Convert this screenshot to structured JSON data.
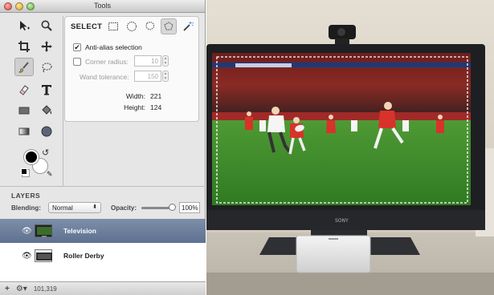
{
  "window": {
    "title": "Tools"
  },
  "tools": [
    {
      "icon": "arrow-move-icon"
    },
    {
      "icon": "magnifier-icon"
    },
    {
      "icon": "crop-icon"
    },
    {
      "icon": "pan-icon"
    },
    {
      "icon": "brush-icon"
    },
    {
      "icon": "lasso-icon"
    },
    {
      "icon": "eraser-icon"
    },
    {
      "icon": "text-icon"
    },
    {
      "icon": "rectangle-icon"
    },
    {
      "icon": "paint-bucket-icon"
    },
    {
      "icon": "gradient-icon"
    },
    {
      "icon": "ellipse-icon"
    }
  ],
  "select_options": {
    "heading": "SELECT",
    "modes": [
      "rect-select-icon",
      "ellipse-select-icon",
      "lasso-select-icon",
      "polygon-select-icon",
      "magic-wand-icon"
    ],
    "anti_alias_label": "Anti-alias selection",
    "anti_alias_checked": true,
    "corner_radius_label": "Corner radius:",
    "corner_radius_value": "10",
    "wand_tolerance_label": "Wand tolerance:",
    "wand_tolerance_value": "150",
    "width_label": "Width:",
    "width_value": "221",
    "height_label": "Height:",
    "height_value": "124"
  },
  "layers": {
    "title": "LAYERS",
    "blending_label": "Blending:",
    "blending_value": "Normal",
    "opacity_label": "Opacity:",
    "opacity_value": "100%",
    "opacity_fraction": 1.0,
    "items": [
      {
        "name": "Television",
        "selected": true
      },
      {
        "name": "Roller Derby",
        "selected": false
      }
    ]
  },
  "status_bar": {
    "add_label": "+",
    "coords": "101,319"
  },
  "photo": {
    "tv_brand": "SONY",
    "selection_color": "#ffffff",
    "field_color": "#3c8a2a",
    "wall_color": "#ded8cc"
  },
  "colors": {
    "selected_layer": "#6a7e9c",
    "panel_bg": "#e6e6e6",
    "red_jersey": "#d8322a"
  }
}
